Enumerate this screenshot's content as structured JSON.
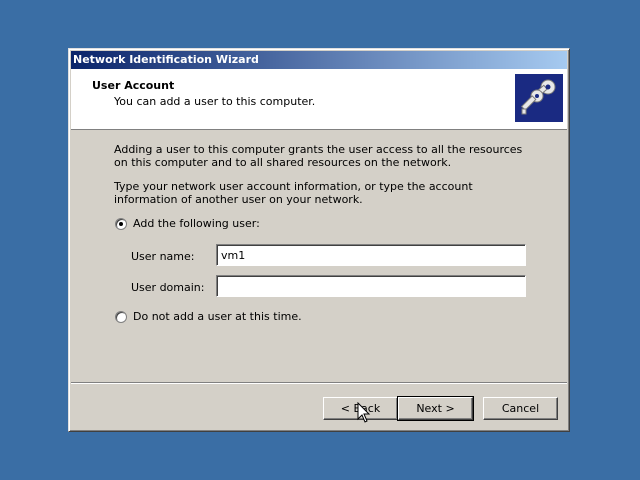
{
  "window": {
    "title": "Network Identification Wizard"
  },
  "header": {
    "title": "User Account",
    "subtitle": "You can add a user to this computer.",
    "icon": "keys-icon"
  },
  "body": {
    "paragraph1": "Adding a user to this computer grants the user access to all the resources on this computer and to all shared resources on the network.",
    "paragraph2": "Type your network user account information, or type the account information of another user on your network.",
    "option_add": {
      "label": "Add the following user:",
      "selected": true
    },
    "user_name": {
      "label": "User name:",
      "value": "vm1"
    },
    "user_domain": {
      "label": "User domain:",
      "value": ""
    },
    "option_none": {
      "label": "Do not add a user at this time.",
      "selected": false
    }
  },
  "buttons": {
    "back": "< Back",
    "next": "Next >",
    "cancel": "Cancel"
  },
  "colors": {
    "desktop": "#3a6ea5",
    "titlebar_start": "#0a246a",
    "titlebar_end": "#a6caf0",
    "dialog": "#d4d0c8"
  }
}
